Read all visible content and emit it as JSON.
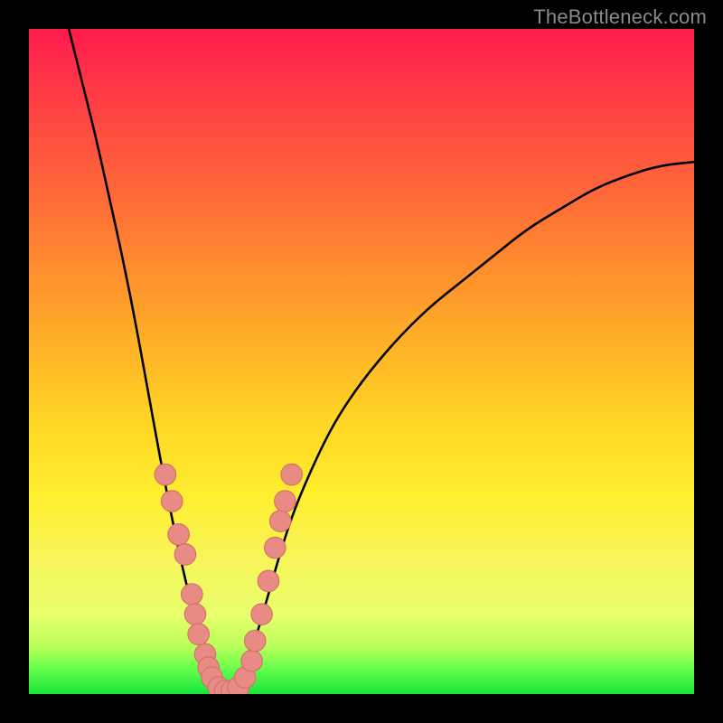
{
  "watermark": "TheBottleneck.com",
  "colors": {
    "curve_stroke": "#000000",
    "dot_fill": "#e98b85",
    "dot_stroke": "#d46f69",
    "gradient": [
      "#ff1a4d",
      "#ff5a3d",
      "#ffb327",
      "#ffee2e",
      "#b8ff5a",
      "#16e63b"
    ]
  },
  "chart_data": {
    "type": "line",
    "title": "",
    "xlabel": "",
    "ylabel": "",
    "xlim": [
      0,
      100
    ],
    "ylim": [
      0,
      100
    ],
    "curve": {
      "notes": "V-shaped bottleneck curve; minimum at x≈28, left branch descends from 100% to ~0 over x=6→28; right branch rises from ~0 to ~80 over x=28→100.",
      "points": [
        [
          6,
          100
        ],
        [
          8,
          92
        ],
        [
          10,
          84
        ],
        [
          12,
          75
        ],
        [
          14,
          66
        ],
        [
          16,
          56
        ],
        [
          18,
          45
        ],
        [
          20,
          34
        ],
        [
          22,
          24
        ],
        [
          24,
          15
        ],
        [
          26,
          8
        ],
        [
          28,
          2
        ],
        [
          29,
          0
        ],
        [
          30,
          0
        ],
        [
          32,
          3
        ],
        [
          34,
          8
        ],
        [
          36,
          15
        ],
        [
          38,
          22
        ],
        [
          40,
          28
        ],
        [
          43,
          35
        ],
        [
          46,
          41
        ],
        [
          50,
          47
        ],
        [
          55,
          53
        ],
        [
          60,
          58
        ],
        [
          65,
          62
        ],
        [
          70,
          66
        ],
        [
          75,
          70
        ],
        [
          80,
          73
        ],
        [
          85,
          76
        ],
        [
          90,
          78
        ],
        [
          95,
          79.5
        ],
        [
          100,
          80
        ]
      ]
    },
    "dots": {
      "notes": "pink data markers clustered around the V bottom on both inner branches",
      "points": [
        [
          20.5,
          33
        ],
        [
          21.5,
          29
        ],
        [
          22.5,
          24
        ],
        [
          23.5,
          21
        ],
        [
          24.5,
          15
        ],
        [
          25,
          12
        ],
        [
          25.5,
          9
        ],
        [
          26.5,
          6
        ],
        [
          27,
          4
        ],
        [
          27.5,
          2.5
        ],
        [
          28.5,
          1
        ],
        [
          29.5,
          0.5
        ],
        [
          30.5,
          0.5
        ],
        [
          31.5,
          1
        ],
        [
          32.5,
          2.5
        ],
        [
          33.5,
          5
        ],
        [
          34,
          8
        ],
        [
          35,
          12
        ],
        [
          36,
          17
        ],
        [
          37,
          22
        ],
        [
          37.8,
          26
        ],
        [
          38.5,
          29
        ],
        [
          39.5,
          33
        ]
      ]
    }
  }
}
